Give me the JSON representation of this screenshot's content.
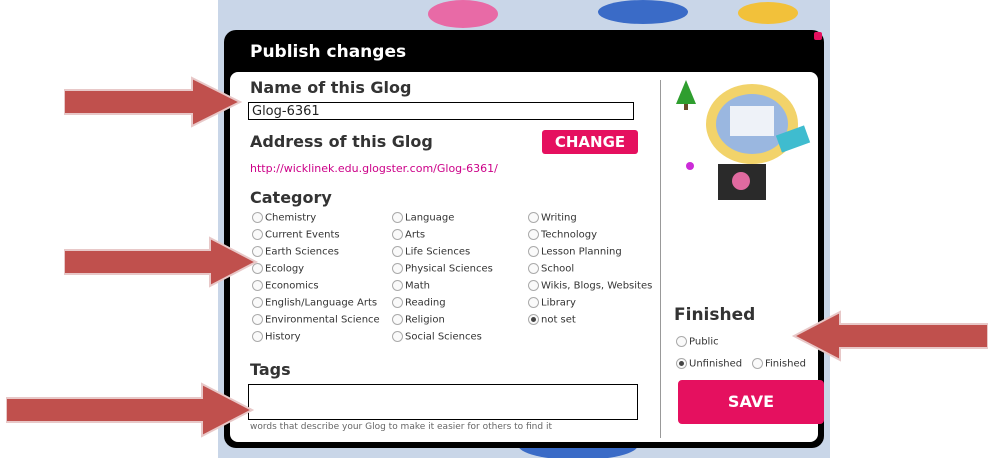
{
  "dialog": {
    "title": "Publish changes",
    "name_heading": "Name of this Glog",
    "name_value": "Glog-6361",
    "address_heading": "Address of this Glog",
    "change_label": "CHANGE",
    "address_url": "http://wicklinek.edu.glogster.com/Glog-6361/",
    "category_heading": "Category",
    "categories": [
      [
        "Chemistry",
        "Language",
        "Writing"
      ],
      [
        "Current Events",
        "Arts",
        "Technology"
      ],
      [
        "Earth Sciences",
        "Life Sciences",
        "Lesson Planning"
      ],
      [
        "Ecology",
        "Physical Sciences",
        "School"
      ],
      [
        "Economics",
        "Math",
        "Wikis, Blogs, Websites"
      ],
      [
        "English/Language Arts",
        "Reading",
        "Library"
      ],
      [
        "Environmental Science",
        "Religion",
        "not set"
      ],
      [
        "History",
        "Social Sciences",
        ""
      ]
    ],
    "selected_category": "not set",
    "tags_heading": "Tags",
    "tags_hint": "words that describe your Glog to make it easier for others to find it",
    "finished_heading": "Finished",
    "public_label": "Public",
    "unfinished_label": "Unfinished",
    "finished_label": "Finished",
    "finished_state": "Unfinished",
    "save_label": "SAVE"
  },
  "colors": {
    "accent": "#e5105f",
    "arrow": "#c0504d",
    "link": "#cc0088"
  }
}
